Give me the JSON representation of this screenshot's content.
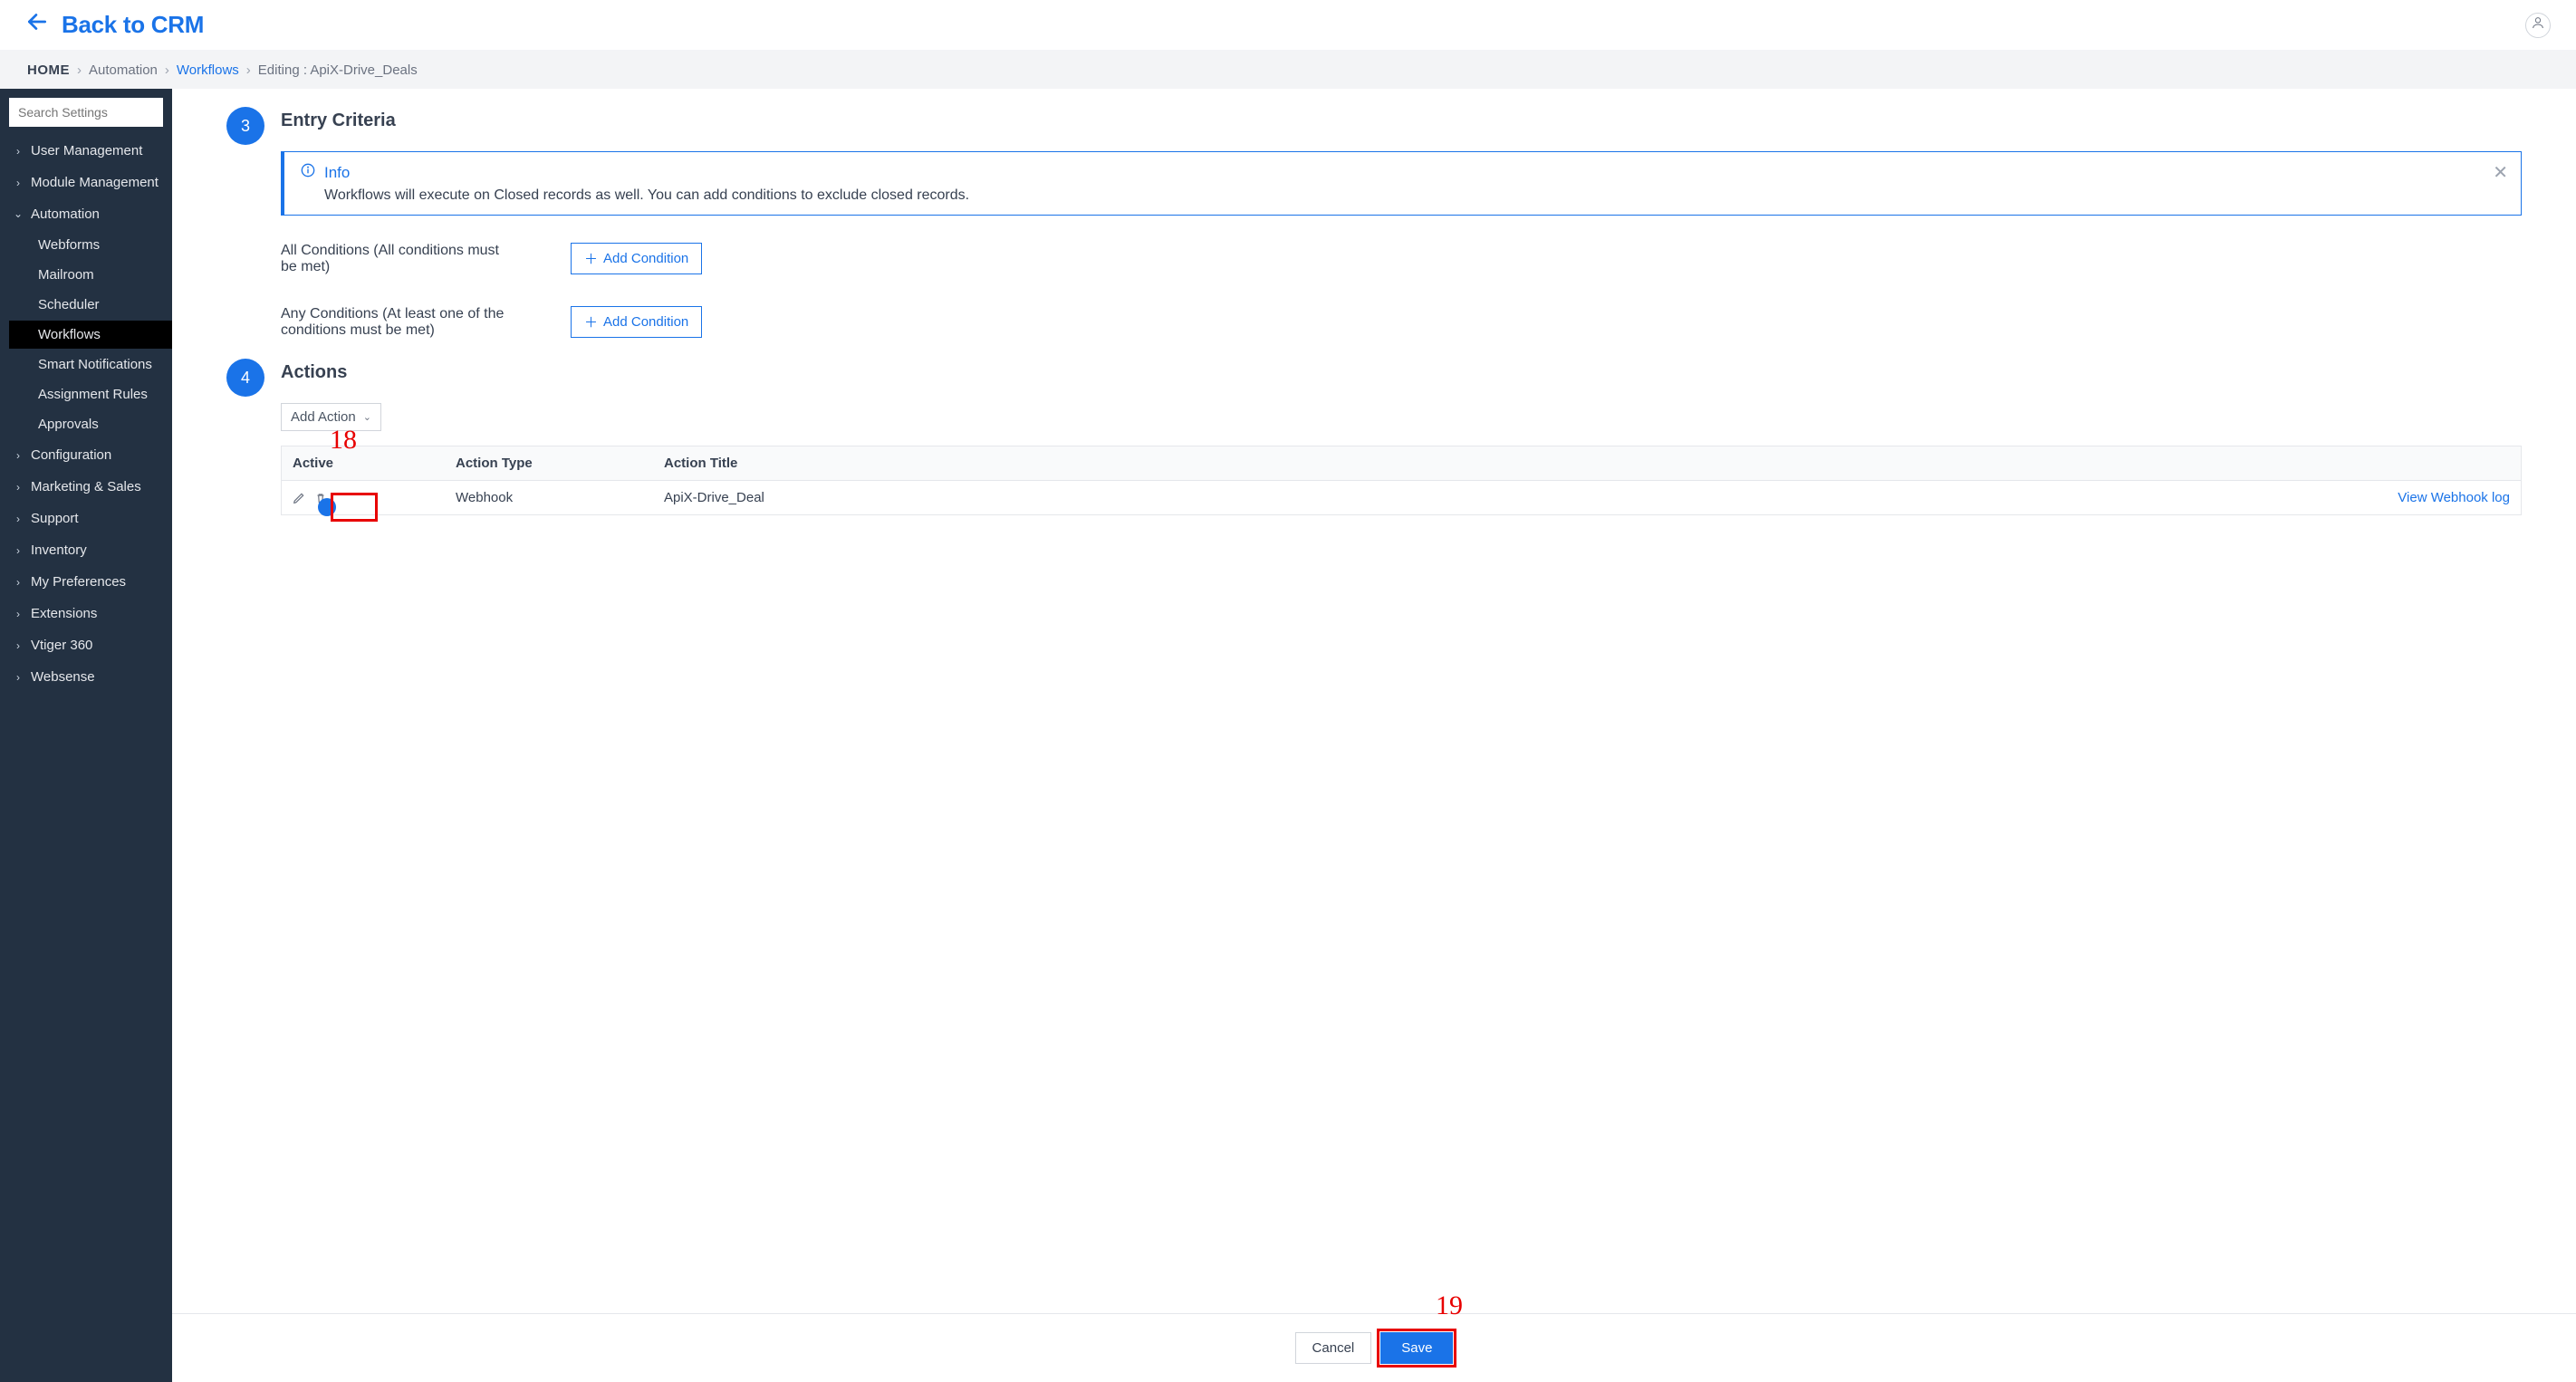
{
  "topbar": {
    "back_label": "Back to CRM"
  },
  "breadcrumb": {
    "home": "HOME",
    "automation": "Automation",
    "workflows": "Workflows",
    "editing": "Editing : ApiX-Drive_Deals"
  },
  "sidebar": {
    "search_placeholder": "Search Settings",
    "user_management": "User Management",
    "module_management": "Module Management",
    "automation": "Automation",
    "automation_children": {
      "webforms": "Webforms",
      "mailroom": "Mailroom",
      "scheduler": "Scheduler",
      "workflows": "Workflows",
      "smart_notifications": "Smart Notifications",
      "assignment_rules": "Assignment Rules",
      "approvals": "Approvals"
    },
    "configuration": "Configuration",
    "marketing_sales": "Marketing & Sales",
    "support": "Support",
    "inventory": "Inventory",
    "my_preferences": "My Preferences",
    "extensions": "Extensions",
    "vtiger360": "Vtiger 360",
    "websense": "Websense"
  },
  "step3": {
    "number": "3",
    "title": "Entry Criteria",
    "info_heading": "Info",
    "info_body": "Workflows will execute on Closed records as well. You can add conditions to exclude closed records.",
    "all_conditions_label": "All Conditions (All conditions must be met)",
    "any_conditions_label": "Any Conditions (At least one of the conditions must be met)",
    "add_condition_label": "Add Condition"
  },
  "step4": {
    "number": "4",
    "title": "Actions",
    "add_action_label": "Add Action",
    "table": {
      "col_active": "Active",
      "col_type": "Action Type",
      "col_title": "Action Title",
      "row0_type": "Webhook",
      "row0_title": "ApiX-Drive_Deal",
      "row0_link": "View Webhook log"
    }
  },
  "footer": {
    "cancel": "Cancel",
    "save": "Save"
  },
  "annotations": {
    "a18": "18",
    "a19": "19"
  }
}
